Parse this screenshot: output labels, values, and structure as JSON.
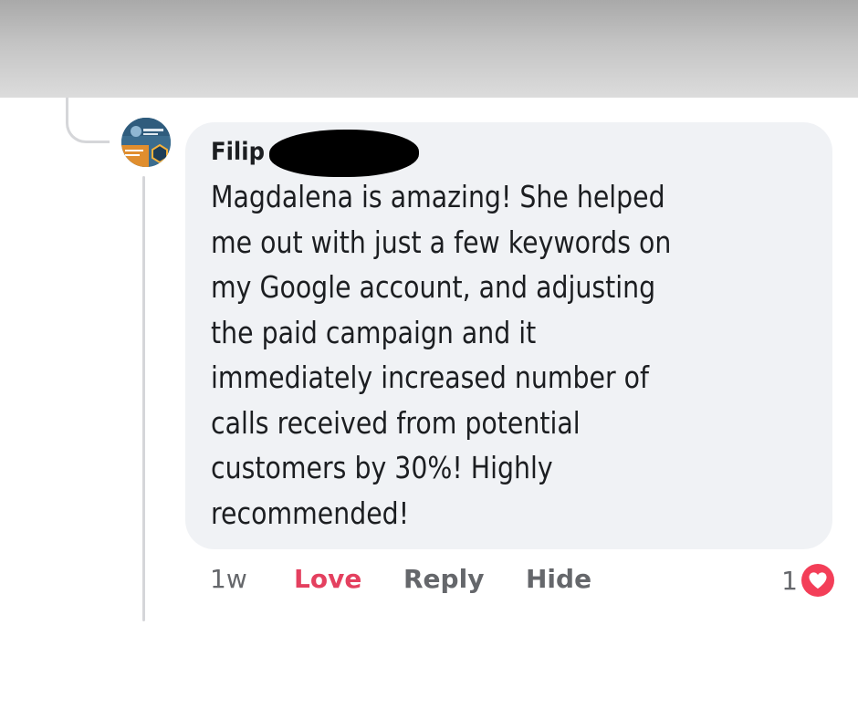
{
  "comment": {
    "author": "Filip",
    "text": "Magdalena is amazing! She helped\nme out with just a few keywords on\nmy Google account, and adjusting\nthe paid campaign and it\nimmediately increased number of\ncalls received from potential\ncustomers by 30%! Highly\nrecommended!",
    "timestamp": "1w",
    "reaction_count": "1"
  },
  "actions": {
    "love": "Love",
    "reply": "Reply",
    "hide": "Hide"
  },
  "icons": {
    "reaction": "heart-icon",
    "avatar": "avatar"
  },
  "colors": {
    "love_active": "#e4405f",
    "heart_badge": "#f33e58",
    "bubble_background": "#f0f2f5",
    "secondary_text": "#65676b"
  }
}
